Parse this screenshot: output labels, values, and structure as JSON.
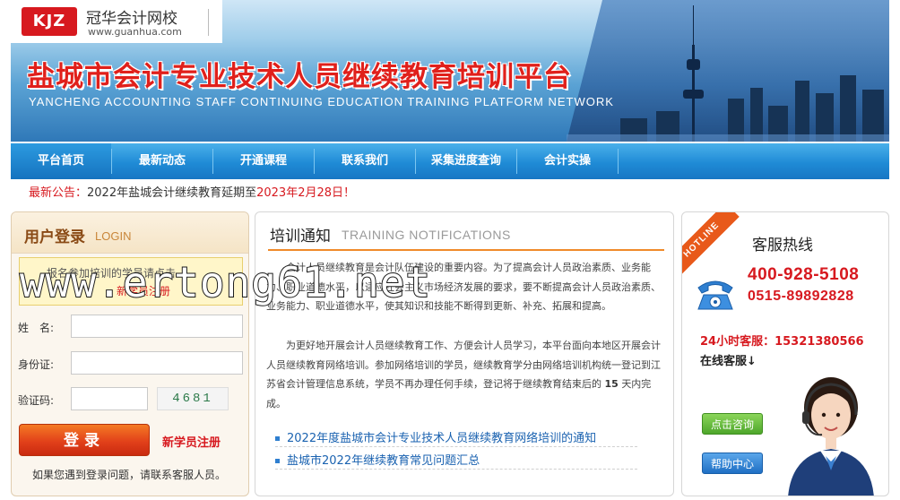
{
  "brand": {
    "badge": "KJZ",
    "name": "冠华会计网校",
    "url": "www.guanhua.com"
  },
  "banner": {
    "title": "盐城市会计专业技术人员继续教育培训平台",
    "subtitle": "YANCHENG ACCOUNTING STAFF CONTINUING EDUCATION TRAINING PLATFORM NETWORK"
  },
  "nav": {
    "items": [
      {
        "label": "平台首页"
      },
      {
        "label": "最新动态"
      },
      {
        "label": "开通课程"
      },
      {
        "label": "联系我们"
      },
      {
        "label": "采集进度查询"
      },
      {
        "label": "会计实操"
      }
    ]
  },
  "notice": {
    "label": "最新公告：",
    "text": "2022年盐城会计继续教育延期至",
    "date": "2023年2月28日！"
  },
  "login": {
    "title": "用户登录",
    "subtitle": "LOGIN",
    "tip_line1": "报名参加培训的学员请点击",
    "tip_line2": "新学员注册",
    "name_label": "姓　名:",
    "id_label": "身份证:",
    "code_label": "验证码:",
    "captcha": "4681",
    "login_button": "登录",
    "register_link": "新学员注册",
    "help_text": "如果您遇到登录问题，请联系客服人员。"
  },
  "training": {
    "title": "培训通知",
    "subtitle": "TRAINING NOTIFICATIONS",
    "paragraph1": "会计人员继续教育是会计队伍建设的重要内容。为了提高会计人员政治素质、业务能力、职业道德水平，以适应社会主义市场经济发展的要求，要不断提高会计人员政治素质、业务能力、职业道德水平，使其知识和技能不断得到更新、补充、拓展和提高。",
    "paragraph2_a": "为更好地开展会计人员继续教育工作、方便会计人员学习，本平台面向本地区开展会计人员继续教育网络培训。参加网络培训的学员，继续教育学分由网络培训机构统一登记到江苏省会计管理信息系统，学员不再办理任何手续，登记将于继续教育结束后的",
    "paragraph2_days": "15",
    "paragraph2_b": "天内完成。",
    "links": [
      "2022年度盐城市会计专业技术人员继续教育网络培训的通知",
      "盐城市2022年继续教育常见问题汇总"
    ]
  },
  "service": {
    "ribbon": "HOTLINE",
    "title": "客服热线",
    "phone_primary": "400-928-5108",
    "phone_secondary": "0515-89892828",
    "hotline_24h": "24小时客服：15321380566",
    "online_label": "在线客服↓",
    "consult_button": "点击咨询",
    "help_button": "帮助中心"
  },
  "watermark": "www.ertong61.net",
  "icons": [
    "phone-icon",
    "customer-service-agent-icon",
    "skyline-illustration"
  ],
  "colors": {
    "brand_red": "#d7191f",
    "nav_blue": "#1f8bd6",
    "accent_orange": "#f08a2a",
    "login_orange": "#e2411a"
  }
}
